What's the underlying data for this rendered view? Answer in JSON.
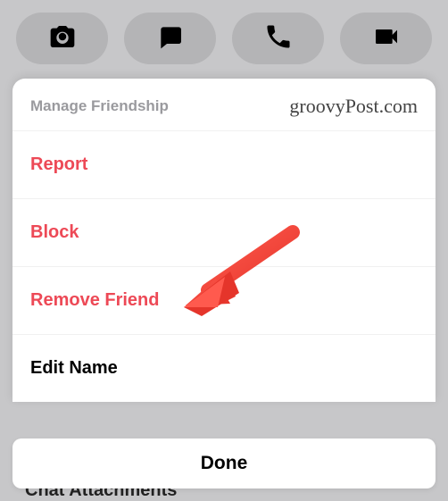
{
  "toolbar": {
    "camera": "camera",
    "chat": "chat",
    "call": "call",
    "video": "video"
  },
  "sheet": {
    "title": "Manage Friendship",
    "watermark": "groovyPost.com",
    "items": {
      "report": "Report",
      "block": "Block",
      "remove": "Remove Friend",
      "editName": "Edit Name"
    }
  },
  "doneButton": "Done",
  "backgroundText": "Chat Attachments"
}
